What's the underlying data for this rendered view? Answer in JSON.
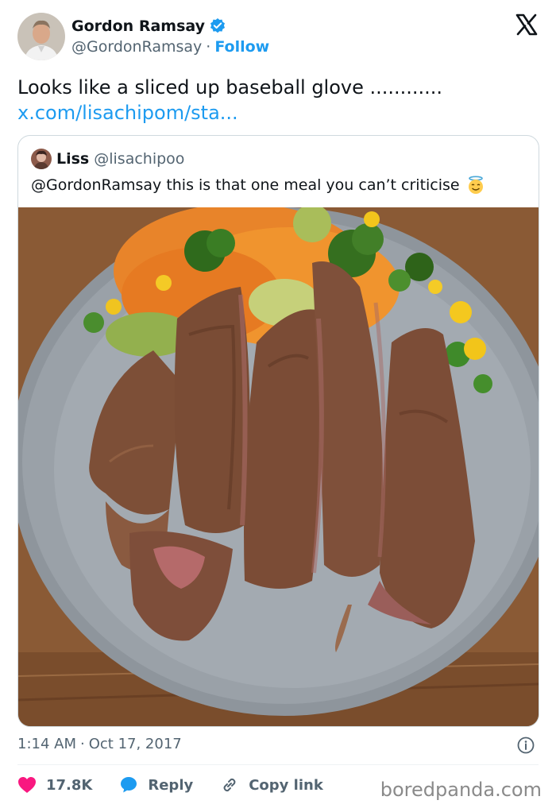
{
  "author": {
    "name": "Gordon Ramsay",
    "handle": "@GordonRamsay",
    "follow_label": "Follow"
  },
  "tweet": {
    "text": "Looks like a sliced up baseball glove ............",
    "link": "x.com/lisachipom/sta..."
  },
  "quote": {
    "name": "Liss",
    "handle": "@lisachipoo",
    "text": "@GordonRamsay this is that one meal you can’t criticise",
    "emoji": "smiling-face-with-halo"
  },
  "meta": {
    "time": "1:14 AM",
    "date": "Oct 17, 2017"
  },
  "actions": {
    "likes": "17.8K",
    "reply_label": "Reply",
    "copy_label": "Copy link"
  },
  "watermark": "boredpanda.com",
  "colors": {
    "accent": "#1d9bf0",
    "like": "#f91880",
    "text": "#0f1419",
    "muted": "#536471"
  }
}
